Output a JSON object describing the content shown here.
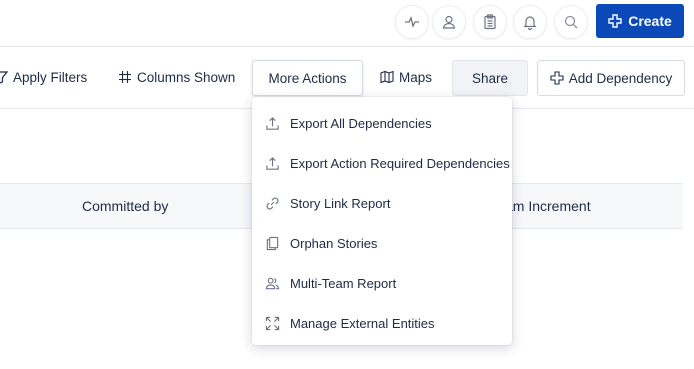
{
  "header": {
    "icons": [
      "pulse-icon",
      "user-icon",
      "clipboard-icon",
      "bell-icon",
      "search-icon"
    ],
    "create_label": "Create"
  },
  "toolbar": {
    "apply_filters": "Apply Filters",
    "columns_shown": "Columns Shown",
    "more_actions": "More Actions",
    "maps": "Maps",
    "share": "Share",
    "add_dependency": "Add Dependency"
  },
  "table": {
    "columns": [
      "Committed by",
      "am Increment"
    ]
  },
  "more_actions_menu": {
    "items": [
      {
        "label": "Export All Dependencies",
        "icon": "upload-icon"
      },
      {
        "label": "Export Action Required Dependencies",
        "icon": "upload-icon"
      },
      {
        "label": "Story Link Report",
        "icon": "link-icon"
      },
      {
        "label": "Orphan Stories",
        "icon": "copy-icon"
      },
      {
        "label": "Multi-Team Report",
        "icon": "users-icon"
      },
      {
        "label": "Manage External Entities",
        "icon": "expand-icon"
      }
    ]
  },
  "colors": {
    "primary": "#0b48b8",
    "text": "#1f2a44",
    "border": "#e6e8ec"
  }
}
